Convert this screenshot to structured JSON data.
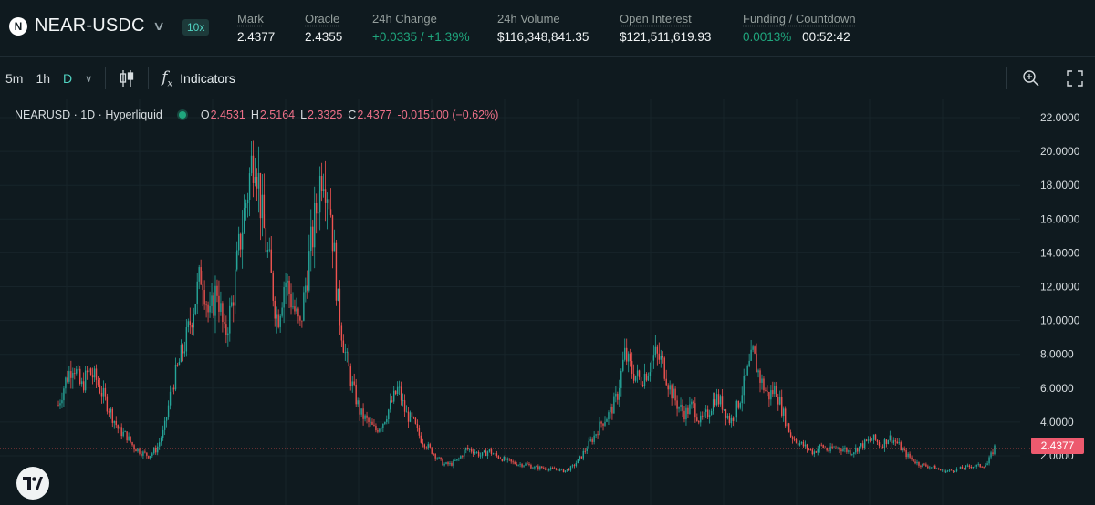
{
  "header": {
    "pair_logo": "N",
    "pair": "NEAR-USDC",
    "leverage": "10x",
    "stats": [
      {
        "label": "Mark",
        "value": "2.4377",
        "underline": true
      },
      {
        "label": "Oracle",
        "value": "2.4355",
        "underline": true
      },
      {
        "label": "24h Change",
        "value": "+0.0335 / +1.39%",
        "underline": false,
        "positive": true
      },
      {
        "label": "24h Volume",
        "value": "$116,348,841.35",
        "underline": false
      },
      {
        "label": "Open Interest",
        "value": "$121,511,619.93",
        "underline": true
      }
    ],
    "funding": {
      "label": "Funding / Countdown",
      "rate": "0.0013%",
      "countdown": "00:52:42"
    }
  },
  "toolbar": {
    "timeframes": [
      "5m",
      "1h",
      "D"
    ],
    "active_timeframe": "D",
    "indicators_label": "Indicators",
    "icons": [
      "chevron-down-icon",
      "candlestick-icon",
      "fx-icon",
      "zoom-icon",
      "fullscreen-icon"
    ]
  },
  "legend": {
    "symbol": "NEARUSD · 1D · Hyperliquid",
    "o_label": "O",
    "o": "2.4531",
    "h_label": "H",
    "h": "2.5164",
    "l_label": "L",
    "l": "2.3325",
    "c_label": "C",
    "c": "2.4377",
    "change": "-0.015100 (−0.62%)"
  },
  "chart_data": {
    "type": "candlestick",
    "title": "NEARUSD · 1D · Hyperliquid",
    "ylim": [
      0,
      22
    ],
    "y_ticks": [
      "22.0000",
      "20.0000",
      "18.0000",
      "16.0000",
      "14.0000",
      "12.0000",
      "10.0000",
      "8.0000",
      "6.0000",
      "4.0000",
      "2.0000"
    ],
    "y_tick_values": [
      22,
      20,
      18,
      16,
      14,
      12,
      10,
      8,
      6,
      4,
      2
    ],
    "current_price": 2.4377,
    "current_price_label": "2.4377",
    "grid": true,
    "approx_close_series": [
      5.0,
      6.5,
      7.5,
      6.0,
      7.0,
      6.5,
      5.5,
      4.5,
      3.5,
      3.2,
      2.5,
      2.2,
      2.0,
      2.4,
      3.5,
      6.0,
      7.5,
      9.0,
      11.0,
      13.0,
      10.0,
      12.0,
      9.0,
      11.0,
      14.5,
      17.5,
      20.5,
      16.0,
      13.0,
      10.0,
      12.5,
      11.0,
      9.5,
      13.0,
      16.0,
      19.5,
      17.0,
      11.0,
      8.0,
      6.0,
      4.5,
      4.0,
      3.5,
      4.0,
      5.0,
      6.0,
      4.5,
      4.0,
      3.0,
      2.5,
      2.0,
      1.5,
      1.5,
      1.8,
      2.4,
      2.3,
      2.0,
      2.3,
      2.0,
      1.8,
      1.6,
      1.5,
      1.5,
      1.3,
      1.3,
      1.2,
      1.2,
      1.1,
      1.3,
      1.8,
      2.5,
      3.2,
      4.0,
      4.5,
      5.5,
      8.0,
      7.0,
      6.5,
      7.0,
      8.0,
      7.5,
      6.0,
      5.0,
      4.5,
      5.0,
      4.0,
      4.5,
      5.5,
      5.0,
      4.0,
      5.0,
      6.5,
      8.0,
      6.5,
      5.5,
      6.0,
      4.5,
      3.2,
      2.8,
      2.5,
      2.2,
      2.6,
      2.3,
      2.5,
      2.4,
      2.2,
      2.5,
      2.8,
      3.0,
      2.6,
      3.1,
      2.8,
      2.2,
      1.8,
      1.5,
      1.4,
      1.3,
      1.1,
      1.1,
      1.2,
      1.3,
      1.4,
      1.4,
      1.5,
      2.5
    ]
  }
}
